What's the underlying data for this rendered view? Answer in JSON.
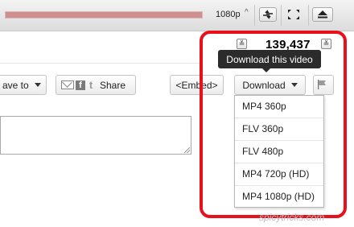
{
  "player": {
    "progress_fraction": 1.0,
    "quality": "1080p",
    "quality_caret": "^",
    "icons": [
      "expand-arrows-icon",
      "fullscreen-icon",
      "eject-icon"
    ]
  },
  "stats": {
    "view_count": "139,437",
    "toggle_glyph": "≚"
  },
  "actions": {
    "save_to": "ave to",
    "share": "Share",
    "embed": "<Embed>",
    "download": "Download",
    "flag_icon": "flag-icon"
  },
  "tooltip": {
    "text": "Download this video"
  },
  "download_options": [
    "MP4 360p",
    "FLV 360p",
    "FLV 480p",
    "MP4 720p (HD)",
    "MP4 1080p (HD)"
  ],
  "watermark": "spicytricks.com",
  "colors": {
    "highlight": "#e8101a",
    "tooltip_bg": "#2b2b2b",
    "progress": "#cf8f8f"
  }
}
